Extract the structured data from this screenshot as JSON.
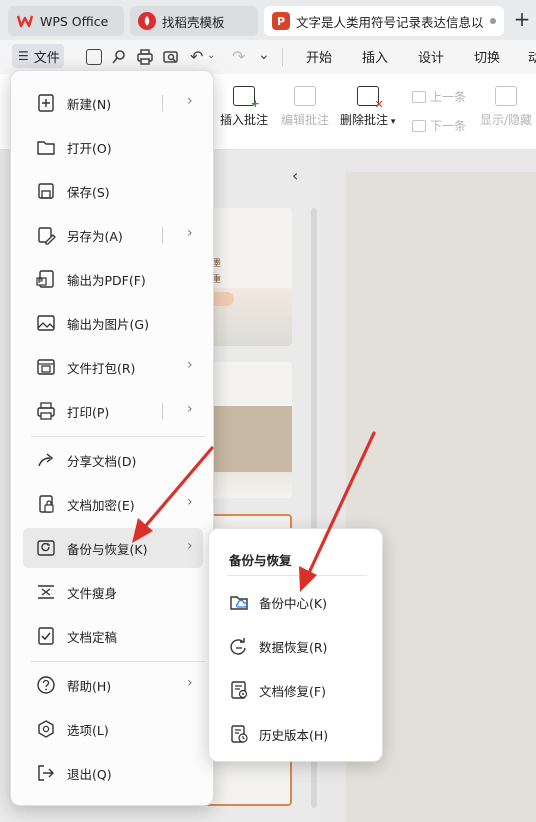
{
  "tabs": [
    {
      "label": "WPS Office",
      "logo": "W"
    },
    {
      "label": "找稻壳模板",
      "logo": "稻"
    },
    {
      "label": "文字是人类用符号记录表达信息以",
      "logo": "P"
    }
  ],
  "new_tab_label": "+",
  "toolbar": {
    "file_label": "文件",
    "menu_tabs": [
      "开始",
      "插入",
      "设计",
      "切换",
      "动"
    ]
  },
  "ribbon": {
    "insert_comment": "插入批注",
    "edit_comment": "编辑批注",
    "delete_comment": "删除批注",
    "prev": "上一条",
    "next": "下一条",
    "show_hide": "显示/隐藏"
  },
  "thumb_text": [
    "墨",
    "重"
  ],
  "file_menu": {
    "items": [
      {
        "label": "新建(N)",
        "icon": "new-file-icon",
        "submenu": true
      },
      {
        "label": "打开(O)",
        "icon": "folder-open-icon",
        "submenu": false
      },
      {
        "label": "保存(S)",
        "icon": "save-icon",
        "submenu": false
      },
      {
        "label": "另存为(A)",
        "icon": "save-as-icon",
        "submenu": true
      },
      {
        "label": "输出为PDF(F)",
        "icon": "pdf-icon",
        "submenu": false
      },
      {
        "label": "输出为图片(G)",
        "icon": "image-icon",
        "submenu": false
      },
      {
        "label": "文件打包(R)",
        "icon": "package-icon",
        "submenu": true
      },
      {
        "label": "打印(P)",
        "icon": "printer-icon",
        "submenu": true
      },
      {
        "label": "分享文档(D)",
        "icon": "share-icon",
        "submenu": false
      },
      {
        "label": "文档加密(E)",
        "icon": "encrypt-icon",
        "submenu": true
      },
      {
        "label": "备份与恢复(K)",
        "icon": "backup-icon",
        "submenu": true,
        "active": true
      },
      {
        "label": "文件瘦身",
        "icon": "slim-icon",
        "submenu": false
      },
      {
        "label": "文档定稿",
        "icon": "finalize-icon",
        "submenu": false
      },
      {
        "label": "帮助(H)",
        "icon": "help-icon",
        "submenu": true
      },
      {
        "label": "选项(L)",
        "icon": "options-icon",
        "submenu": false
      },
      {
        "label": "退出(Q)",
        "icon": "exit-icon",
        "submenu": false
      }
    ]
  },
  "backup_submenu": {
    "title": "备份与恢复",
    "items": [
      {
        "label": "备份中心(K)",
        "icon": "backup-center-icon"
      },
      {
        "label": "数据恢复(R)",
        "icon": "data-recovery-icon"
      },
      {
        "label": "文档修复(F)",
        "icon": "doc-repair-icon"
      },
      {
        "label": "历史版本(H)",
        "icon": "history-version-icon"
      }
    ]
  },
  "colors": {
    "arrow": "#d9302a",
    "wps_red": "#e2312a",
    "menu_active_bg": "#e9e9ea"
  }
}
